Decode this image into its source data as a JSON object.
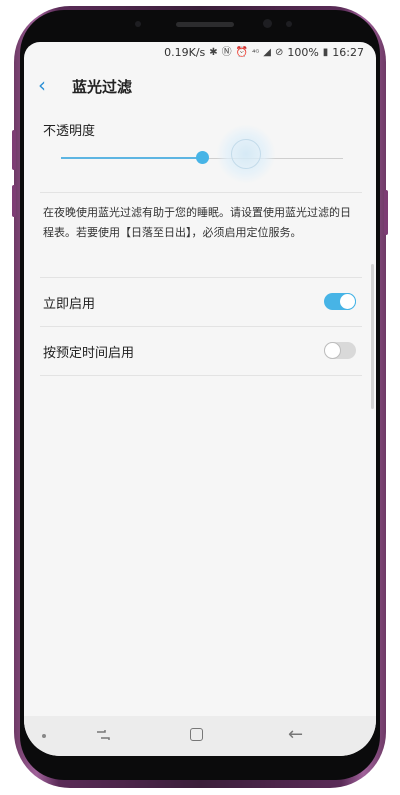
{
  "status_bar": {
    "speed": "0.19K/s",
    "icons": [
      "bluetooth-icon",
      "nfc-icon",
      "alarm-icon",
      "wifi-4g-icon",
      "signal-icon",
      "dnd-icon"
    ],
    "battery": "100%",
    "time": "16:27"
  },
  "header": {
    "title": "蓝光过滤"
  },
  "opacity": {
    "label": "不透明度",
    "value_fraction": 0.5
  },
  "description": "在夜晚使用蓝光过滤有助于您的睡眠。请设置使用蓝光过滤的日程表。若要使用【日落至日出】，必须启用定位服务。",
  "settings": [
    {
      "label": "立即启用",
      "enabled": true
    },
    {
      "label": "按预定时间启用",
      "enabled": false
    }
  ],
  "colors": {
    "accent": "#47b4e6",
    "frame": "#7d3d74"
  }
}
